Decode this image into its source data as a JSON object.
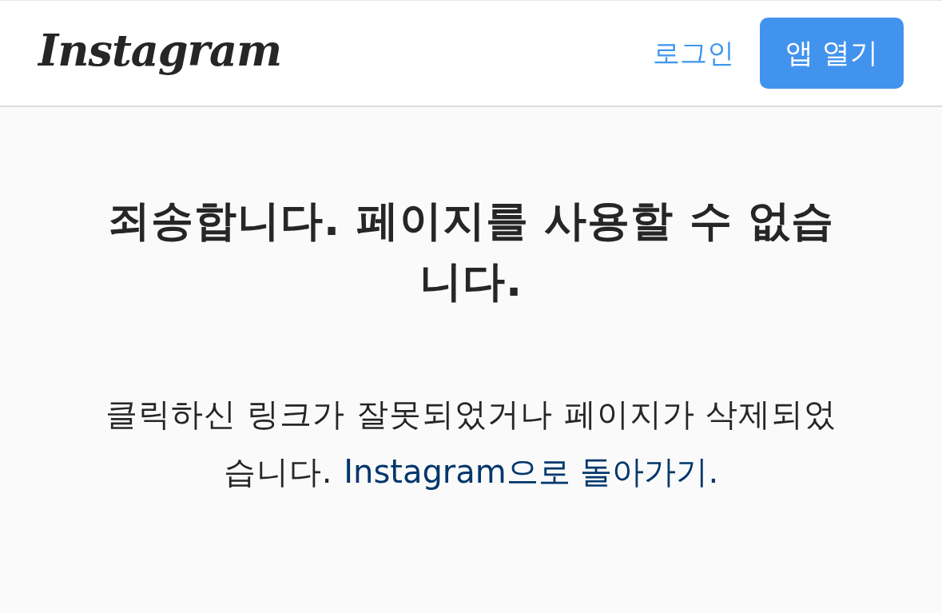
{
  "header": {
    "logo": "Instagram",
    "login_link": "로그인",
    "open_app_button": "앱 열기"
  },
  "error": {
    "title": "죄송합니다. 페이지를 사용할 수 없습니다.",
    "message": "클릭하신 링크가 잘못되었거나 페이지가 삭제되었습니다.",
    "back_link": "Instagram으로 돌아가기."
  }
}
